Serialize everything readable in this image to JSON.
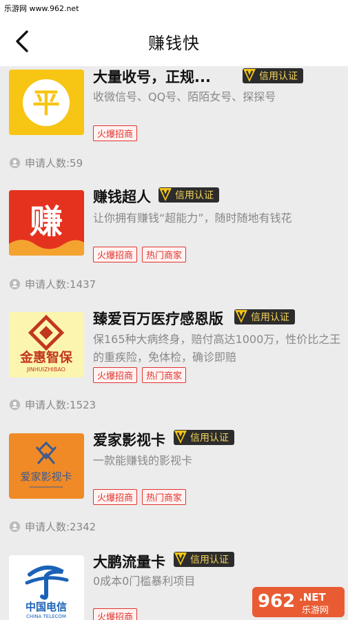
{
  "watermark_top": "乐游网 www.962.net",
  "header": {
    "title": "赚钱快",
    "back_icon": "chevron-left-icon"
  },
  "credit_label": "信用认证",
  "applicant_prefix": "申请人数:",
  "items": [
    {
      "title": "大量收号，正规...",
      "desc": "收微信号、QQ号、陌陌女号、探探号",
      "tags": [
        "火爆招商"
      ],
      "applicants": "申请人数:59",
      "logo_color": "#f7c513"
    },
    {
      "title": "赚钱超人",
      "desc": "让你拥有赚钱“超能力”，随时随地有钱花",
      "tags": [
        "火爆招商",
        "热门商家"
      ],
      "applicants": "申请人数:1437",
      "logo_color": "#e5321f",
      "logo_text": "赚"
    },
    {
      "title": "臻爱百万医疗感恩版",
      "desc": "保165种大病终身，赔付高达1000万，性价比之王的重疾险，免体检，确诊即赔",
      "tags": [
        "火爆招商",
        "热门商家"
      ],
      "applicants": "申请人数:1523",
      "logo_color": "#fcf5b0",
      "logo_text": "金惠智保",
      "logo_subtext": "JINHUIZHIBAO"
    },
    {
      "title": "爱家影视卡",
      "desc": "一款能赚钱的影视卡",
      "tags": [
        "火爆招商",
        "热门商家"
      ],
      "applicants": "申请人数:2342",
      "logo_color": "#f08a26",
      "logo_text": "爱家影视卡"
    },
    {
      "title": "大鹏流量卡",
      "desc": "0成本0门槛暴利项目",
      "tags": [
        "火爆招商"
      ],
      "logo_color": "#ffffff",
      "logo_text": "中国电信",
      "logo_subtext": "CHINA TELECOM"
    }
  ],
  "watermark_br": {
    "main": "962",
    "suffix": ".NET",
    "sub": "乐游网"
  }
}
